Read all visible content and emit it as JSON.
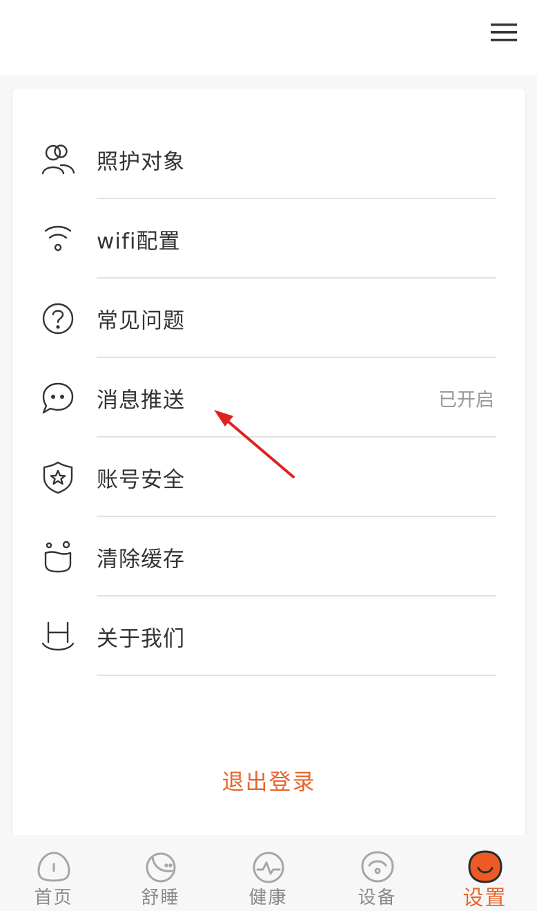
{
  "colors": {
    "accent": "#e8652d",
    "text": "#333333",
    "muted": "#999999",
    "divider": "#e2e2e2",
    "tab_inactive": "#8a8a8a"
  },
  "header": {
    "menu_icon": "hamburger-menu-icon"
  },
  "menu": {
    "items": [
      {
        "icon": "people-icon",
        "label": "照护对象",
        "value": ""
      },
      {
        "icon": "wifi-icon",
        "label": "wifi配置",
        "value": ""
      },
      {
        "icon": "question-icon",
        "label": "常见问题",
        "value": ""
      },
      {
        "icon": "chat-bubble-icon",
        "label": "消息推送",
        "value": "已开启"
      },
      {
        "icon": "shield-star-icon",
        "label": "账号安全",
        "value": ""
      },
      {
        "icon": "cache-pot-icon",
        "label": "清除缓存",
        "value": ""
      },
      {
        "icon": "about-logo-icon",
        "label": "关于我们",
        "value": ""
      }
    ]
  },
  "logout": {
    "label": "退出登录"
  },
  "tabbar": {
    "tabs": [
      {
        "icon": "home-icon",
        "label": "首页",
        "active": false
      },
      {
        "icon": "moon-icon",
        "label": "舒睡",
        "active": false
      },
      {
        "icon": "pulse-icon",
        "label": "健康",
        "active": false
      },
      {
        "icon": "device-icon",
        "label": "设备",
        "active": false
      },
      {
        "icon": "settings-face-icon",
        "label": "设置",
        "active": true
      }
    ]
  }
}
